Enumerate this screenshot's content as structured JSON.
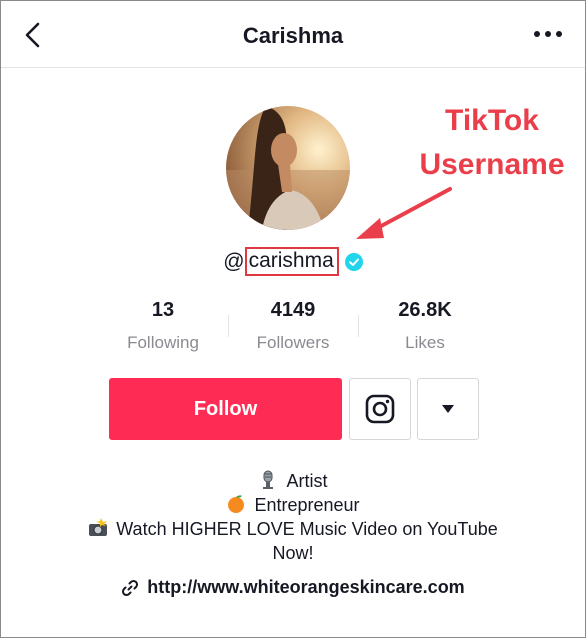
{
  "header": {
    "title": "Carishma"
  },
  "profile": {
    "handle_prefix": "@",
    "handle": "carishma"
  },
  "annotation": {
    "line1": "TikTok",
    "line2": "Username"
  },
  "stats": [
    {
      "value": "13",
      "label": "Following"
    },
    {
      "value": "4149",
      "label": "Followers"
    },
    {
      "value": "26.8K",
      "label": "Likes"
    }
  ],
  "actions": {
    "follow_label": "Follow"
  },
  "bio": {
    "lines": [
      "Artist",
      "Entrepreneur",
      "Watch HIGHER LOVE Music Video on YouTube",
      "Now!"
    ]
  },
  "link": {
    "url": "http://www.whiteorangeskincare.com"
  },
  "colors": {
    "follow": "#fe2c55",
    "annotation": "#ea3f4b",
    "verified": "#20d5ec"
  },
  "icons": [
    "back-chevron-icon",
    "more-dots-icon",
    "verified-badge-icon",
    "instagram-icon",
    "caret-down-icon",
    "microphone-icon",
    "orange-icon",
    "camera-flash-icon",
    "link-icon"
  ]
}
